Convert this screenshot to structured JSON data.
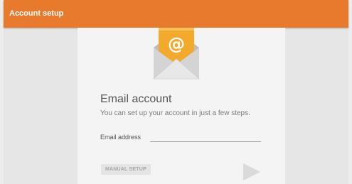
{
  "appbar": {
    "title": "Account setup",
    "color": "#e87a2e"
  },
  "card": {
    "icon": "email-envelope-icon",
    "heading": "Email account",
    "subtext": "You can set up your account in just a few steps.",
    "email_label": "Email address",
    "email_value": "",
    "manual_setup_label": "MANUAL SETUP",
    "next_icon": "next-arrow-icon"
  }
}
